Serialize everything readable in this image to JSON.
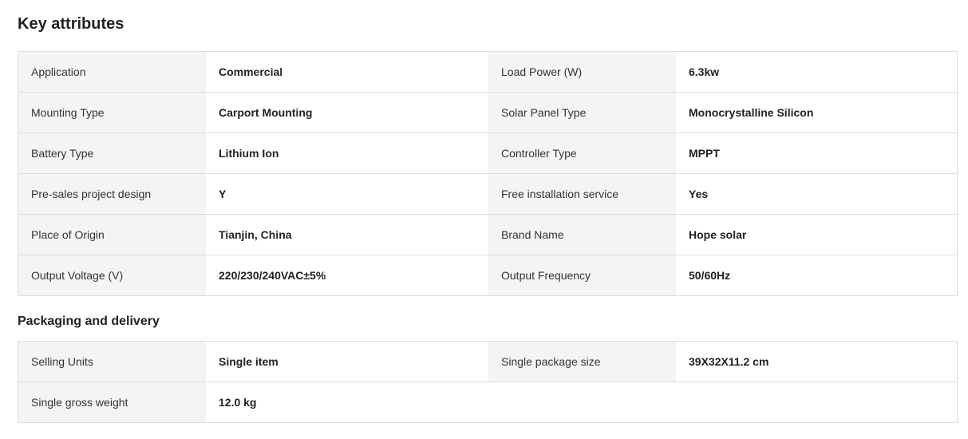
{
  "key_attributes": {
    "title": "Key attributes",
    "rows": [
      {
        "label1": "Application",
        "value1": "Commercial",
        "label2": "Load Power (W)",
        "value2": "6.3kw"
      },
      {
        "label1": "Mounting Type",
        "value1": "Carport Mounting",
        "label2": "Solar Panel Type",
        "value2": "Monocrystalline Silicon"
      },
      {
        "label1": "Battery Type",
        "value1": "Lithium Ion",
        "label2": "Controller Type",
        "value2": "MPPT"
      },
      {
        "label1": "Pre-sales project design",
        "value1": "Y",
        "label2": "Free installation service",
        "value2": "Yes"
      },
      {
        "label1": "Place of Origin",
        "value1": "Tianjin, China",
        "label2": "Brand Name",
        "value2": "Hope solar"
      },
      {
        "label1": "Output Voltage (V)",
        "value1": "220/230/240VAC±5%",
        "label2": "Output Frequency",
        "value2": "50/60Hz"
      }
    ]
  },
  "packaging": {
    "title": "Packaging and delivery",
    "rows": [
      {
        "label1": "Selling Units",
        "value1": "Single item",
        "label2": "Single package size",
        "value2": "39X32X11.2 cm"
      },
      {
        "label1": "Single gross weight",
        "value1": "12.0 kg"
      }
    ]
  },
  "colors": {
    "label_bg": "#f4f4f4",
    "border": "#dddddd",
    "text": "#222222"
  }
}
